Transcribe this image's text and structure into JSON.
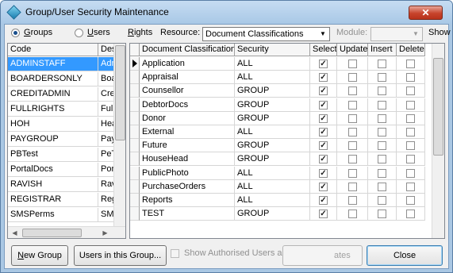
{
  "window": {
    "title": "Group/User Security Maintenance",
    "close_label": "✕"
  },
  "toolbar": {
    "groups_label": "Groups",
    "users_label": "Users",
    "rights_label": "Rights",
    "resource_label": "Resource:",
    "resource_value": "Document Classifications",
    "module_label": "Module:",
    "module_value": "",
    "show_label": "Show"
  },
  "left_grid": {
    "headers": [
      "Code",
      "Des"
    ],
    "rows": [
      {
        "code": "ADMINSTAFF",
        "desc": "Adn"
      },
      {
        "code": "BOARDERSONLY",
        "desc": "Boa"
      },
      {
        "code": "CREDITADMIN",
        "desc": "Cre"
      },
      {
        "code": "FULLRIGHTS",
        "desc": "Full"
      },
      {
        "code": "HOH",
        "desc": "Hea"
      },
      {
        "code": "PAYGROUP",
        "desc": "Pay"
      },
      {
        "code": "PBTest",
        "desc": "PeT"
      },
      {
        "code": "PortalDocs",
        "desc": "Por"
      },
      {
        "code": "RAVISH",
        "desc": "Rav"
      },
      {
        "code": "REGISTRAR",
        "desc": "Reg"
      },
      {
        "code": "SMSPerms",
        "desc": "SMS"
      }
    ]
  },
  "right_grid": {
    "headers": [
      "Document Classification",
      "Security",
      "Select",
      "Update",
      "Insert",
      "Delete"
    ],
    "rows": [
      {
        "name": "Application",
        "security": "ALL",
        "select": true,
        "update": false,
        "insert": false,
        "delete": false
      },
      {
        "name": "Appraisal",
        "security": "ALL",
        "select": true,
        "update": false,
        "insert": false,
        "delete": false
      },
      {
        "name": "Counsellor",
        "security": "GROUP",
        "select": true,
        "update": false,
        "insert": false,
        "delete": false
      },
      {
        "name": "DebtorDocs",
        "security": "GROUP",
        "select": true,
        "update": false,
        "insert": false,
        "delete": false
      },
      {
        "name": "Donor",
        "security": "GROUP",
        "select": true,
        "update": false,
        "insert": false,
        "delete": false
      },
      {
        "name": "External",
        "security": "ALL",
        "select": true,
        "update": false,
        "insert": false,
        "delete": false
      },
      {
        "name": "Future",
        "security": "GROUP",
        "select": true,
        "update": false,
        "insert": false,
        "delete": false
      },
      {
        "name": "HouseHead",
        "security": "GROUP",
        "select": true,
        "update": false,
        "insert": false,
        "delete": false
      },
      {
        "name": "PublicPhoto",
        "security": "ALL",
        "select": true,
        "update": false,
        "insert": false,
        "delete": false
      },
      {
        "name": "PurchaseOrders",
        "security": "ALL",
        "select": true,
        "update": false,
        "insert": false,
        "delete": false
      },
      {
        "name": "Reports",
        "security": "ALL",
        "select": true,
        "update": false,
        "insert": false,
        "delete": false
      },
      {
        "name": "TEST",
        "security": "GROUP",
        "select": true,
        "update": false,
        "insert": false,
        "delete": false
      }
    ]
  },
  "footer": {
    "new_group_label": "New Group",
    "users_in_group_label": "Users in this Group...",
    "show_authorised_label": "Show Authorised Users and Groups",
    "updates_label": "ates",
    "close_label": "Close"
  }
}
